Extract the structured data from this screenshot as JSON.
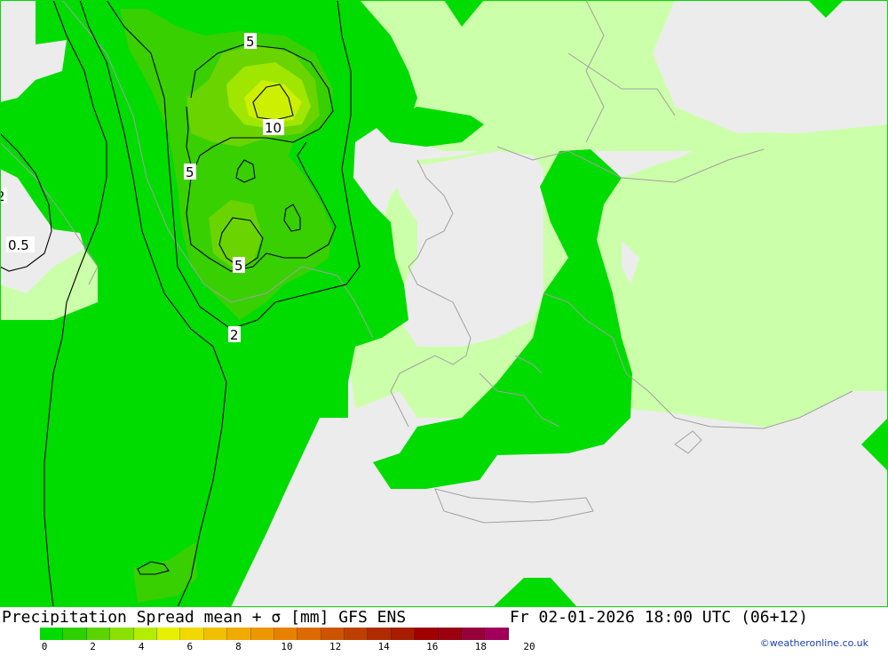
{
  "title": {
    "left": "Precipitation Spread mean + σ [mm] GFS ENS",
    "right": "Fr 02-01-2026 18:00 UTC (06+12)"
  },
  "map": {
    "contour_labels": [
      "5",
      "10",
      "5",
      "5",
      "2",
      "0.5",
      "2"
    ],
    "colors": {
      "land": "#ececec",
      "light_green": "#ccffaa",
      "green": "#00dc00",
      "green2": "#38d000",
      "green3": "#6ad400",
      "green4": "#a0e600",
      "yellow_green": "#ccf000",
      "coast": "#a0a0a0",
      "contour": "#000000"
    }
  },
  "legend": {
    "colors": [
      "#00dc00",
      "#2fd000",
      "#5cd400",
      "#8ae000",
      "#b4ec00",
      "#e6f000",
      "#f0d800",
      "#f0c000",
      "#f0aa00",
      "#ee9600",
      "#e88000",
      "#dc6a00",
      "#cc5400",
      "#be4000",
      "#b02c00",
      "#a81c00",
      "#a00000",
      "#9a0010",
      "#98003a",
      "#a0005a"
    ],
    "tick_labels": [
      "0",
      "2",
      "4",
      "6",
      "8",
      "10",
      "12",
      "14",
      "16",
      "18",
      "20"
    ]
  },
  "credit": "©weatheronline.co.uk"
}
